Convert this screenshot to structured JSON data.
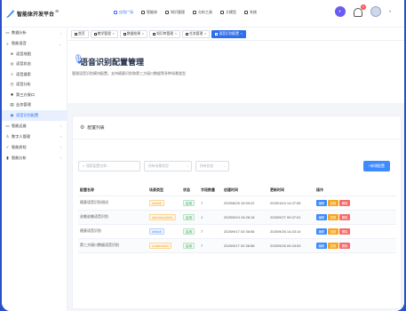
{
  "app": {
    "brand": "智能体开发平台",
    "menu_toggle": "≡"
  },
  "topnav": [
    {
      "label": "应用广场",
      "icon": "grid-icon",
      "active": true
    },
    {
      "label": "智能体",
      "icon": "robot-icon"
    },
    {
      "label": "知识管理",
      "icon": "book-icon"
    },
    {
      "label": "分析工具",
      "icon": "chart-icon"
    },
    {
      "label": "大模型",
      "icon": "cube-icon"
    },
    {
      "label": "系统",
      "icon": "gear-icon"
    }
  ],
  "header_right": {
    "notification_count": "9",
    "avatar_caret": "▾"
  },
  "sidebar": [
    {
      "label": "数据分析",
      "icon": "monitor-icon",
      "arrow": "›"
    },
    {
      "label": "智能语音",
      "icon": "search-icon",
      "arrow": "⌄"
    },
    {
      "label": "语音地图",
      "icon": "send-icon",
      "sub": true
    },
    {
      "label": "语音状态",
      "icon": "target-icon",
      "sub": true
    },
    {
      "label": "语音搜索",
      "icon": "search-icon",
      "sub": true
    },
    {
      "label": "语音分析",
      "icon": "clock-icon",
      "sub": true
    },
    {
      "label": "第三方接口",
      "icon": "gear-icon",
      "sub": true
    },
    {
      "label": "业务管理",
      "icon": "doc-icon",
      "sub": true
    },
    {
      "label": "语音识别配置",
      "icon": "mic-icon",
      "sub": true,
      "active": true
    },
    {
      "label": "智能运维",
      "icon": "monitor-icon",
      "arrow": "›"
    },
    {
      "label": "数字人管理",
      "icon": "user-icon",
      "arrow": "›"
    },
    {
      "label": "智能质检",
      "icon": "check-icon",
      "arrow": "›"
    },
    {
      "label": "智能分析",
      "icon": "bar-icon",
      "arrow": "›"
    }
  ],
  "tabs": [
    {
      "label": "首页",
      "active": false
    },
    {
      "label": "教学管理",
      "active": false
    },
    {
      "label": "数据结果",
      "active": false
    },
    {
      "label": "知识库管理",
      "active": false
    },
    {
      "label": "任务管理",
      "active": false
    },
    {
      "label": "语音识别配置",
      "active": true
    }
  ],
  "page": {
    "title": "语音识别配置管理",
    "description": "管理语音识别模块配置，支持随意识别和第三方接口数据等多种场景类型"
  },
  "card": {
    "title": "配置列表",
    "search_placeholder": "搜索配置名称...",
    "type_placeholder": "所有场景类型",
    "status_placeholder": "所有状态",
    "new_button": "+新增配置",
    "columns": [
      "配置名称",
      "场景类型",
      "状态",
      "字段数量",
      "创建时间",
      "更新时间",
      "操作"
    ],
    "rows": [
      {
        "name": "随意语音识别测试",
        "type": "default",
        "type_color": "orange",
        "status": "启用",
        "count": "7",
        "created": "2025/8/25 15:59:22",
        "updated": "2025/10/4 14:37:55"
      },
      {
        "name": "说着说着语音识别",
        "type": "laboratory(text)",
        "type_color": "orange",
        "status": "启用",
        "count": "1",
        "created": "2025/9/24 15:28:18",
        "updated": "2025/9/27 09:37:01"
      },
      {
        "name": "随意语音识别",
        "type": "default",
        "type_color": "blue",
        "status": "启用",
        "count": "7",
        "created": "2025/9/17 02:36:58",
        "updated": "2025/9/26 14:33:14"
      },
      {
        "name": "第三方接口数据语音识别",
        "type": "construction",
        "type_color": "orange",
        "status": "启用",
        "count": "7",
        "created": "2025/9/17 02:36:58",
        "updated": "2025/9/26 09:43:53"
      }
    ],
    "actions": {
      "edit": "编辑",
      "copy": "复制",
      "delete": "删除"
    }
  },
  "colors": {
    "primary": "#2f6fed",
    "sidebar_border": "#2a4fc7"
  }
}
